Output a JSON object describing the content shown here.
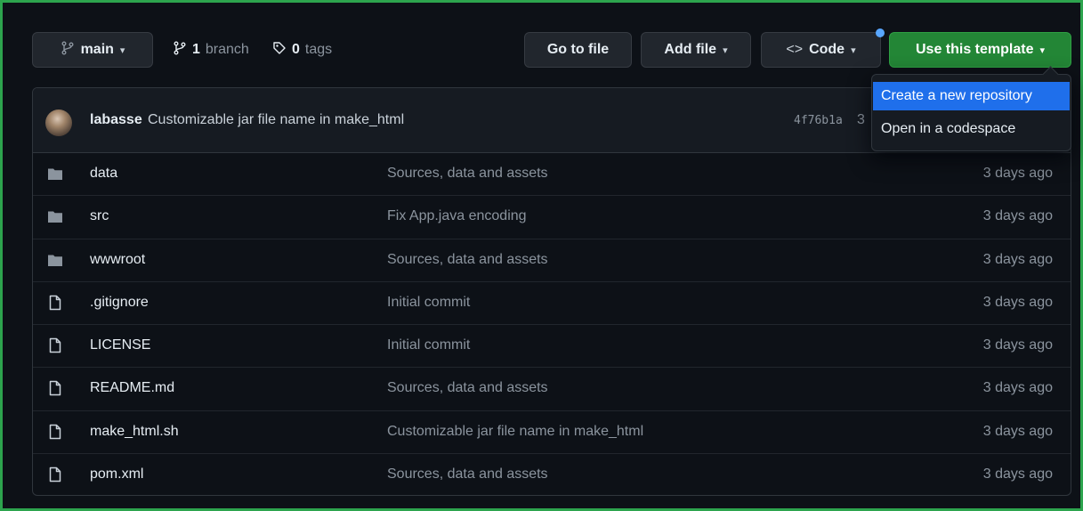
{
  "toolbar": {
    "branch_name": "main",
    "branch_count": "1",
    "branch_label": "branch",
    "tag_count": "0",
    "tag_label": "tags",
    "go_to_file": "Go to file",
    "add_file": "Add file",
    "code": "Code",
    "use_template": "Use this template"
  },
  "dropdown": {
    "items": [
      {
        "label": "Create a new repository",
        "active": true
      },
      {
        "label": "Open in a codespace",
        "active": false
      }
    ]
  },
  "commit": {
    "author": "labasse",
    "message": "Customizable jar file name in make_html",
    "sha": "4f76b1a",
    "sha_tail": "3"
  },
  "files": [
    {
      "name": "data",
      "type": "folder",
      "message": "Sources, data and assets",
      "age": "3 days ago"
    },
    {
      "name": "src",
      "type": "folder",
      "message": "Fix App.java encoding",
      "age": "3 days ago"
    },
    {
      "name": "wwwroot",
      "type": "folder",
      "message": "Sources, data and assets",
      "age": "3 days ago"
    },
    {
      "name": ".gitignore",
      "type": "file",
      "message": "Initial commit",
      "age": "3 days ago"
    },
    {
      "name": "LICENSE",
      "type": "file",
      "message": "Initial commit",
      "age": "3 days ago"
    },
    {
      "name": "README.md",
      "type": "file",
      "message": "Sources, data and assets",
      "age": "3 days ago"
    },
    {
      "name": "make_html.sh",
      "type": "file",
      "message": "Customizable jar file name in make_html",
      "age": "3 days ago"
    },
    {
      "name": "pom.xml",
      "type": "file",
      "message": "Sources, data and assets",
      "age": "3 days ago"
    }
  ],
  "colors": {
    "background": "#0d1117",
    "accent_green": "#238636",
    "highlight_blue": "#1f6feb",
    "frame_green": "#2da44e"
  },
  "icons": {
    "branch": "git-branch-icon",
    "tag": "tag-icon",
    "code": "code-icon",
    "folder": "folder-icon",
    "file": "file-icon"
  }
}
